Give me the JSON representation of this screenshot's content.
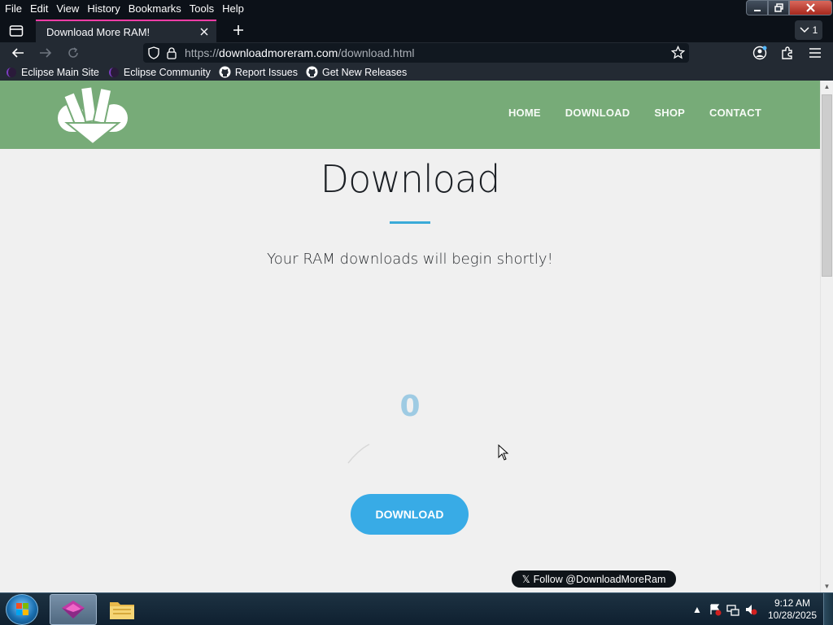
{
  "browser": {
    "menus": [
      "File",
      "Edit",
      "View",
      "History",
      "Bookmarks",
      "Tools",
      "Help"
    ],
    "tab_title": "Download More RAM!",
    "tab_count": "1",
    "url_scheme": "https://",
    "url_host": "downloadmoreram.com",
    "url_path": "/download.html",
    "bookmarks": [
      "Eclipse Main Site",
      "Eclipse Community",
      "Report Issues",
      "Get New Releases"
    ]
  },
  "site": {
    "nav": [
      "HOME",
      "DOWNLOAD",
      "SHOP",
      "CONTACT"
    ],
    "heading": "Download",
    "subtitle": "Your RAM downloads will begin shortly!",
    "counter": "0",
    "download_label": "DOWNLOAD",
    "twitter_label": "Follow @DownloadMoreRam",
    "twitter_icon": "𝕏",
    "header_color": "#77ab78",
    "accent_color": "#38abe6"
  },
  "taskbar": {
    "time": "9:12 AM",
    "date": "10/28/2025"
  }
}
